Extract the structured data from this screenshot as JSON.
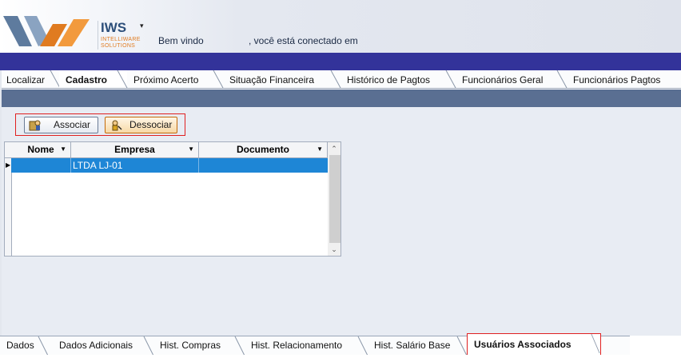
{
  "header": {
    "brand_name": "IWS",
    "brand_sub1": "INTELLIWARE",
    "brand_sub2": "SOLUTIONS",
    "menu_arrow": "▾",
    "welcome": "Bem vindo",
    "connected": ", você está conectado em"
  },
  "top_tabs": [
    {
      "label": "Localizar"
    },
    {
      "label": "Cadastro",
      "active": true
    },
    {
      "label": "Próximo Acerto"
    },
    {
      "label": "Situação Financeira"
    },
    {
      "label": "Histórico de Pagtos"
    },
    {
      "label": "Funcionários Geral"
    },
    {
      "label": "Funcionários Pagtos"
    }
  ],
  "toolbar": {
    "associar_label": "Associar",
    "dessociar_label": "Dessociar"
  },
  "grid": {
    "columns": [
      "Nome",
      "Empresa",
      "Documento"
    ],
    "rows": [
      {
        "nome": "",
        "empresa": "LTDA LJ-01",
        "documento": "",
        "selected": true
      }
    ]
  },
  "bottom_tabs": [
    {
      "label": "Dados"
    },
    {
      "label": "Dados Adicionais"
    },
    {
      "label": "Hist. Compras"
    },
    {
      "label": "Hist. Relacionamento"
    },
    {
      "label": "Hist. Salário Base"
    },
    {
      "label": "Usuários Associados",
      "active": true
    }
  ],
  "colors": {
    "navbar": "#33339a",
    "section_bar": "#5a6f92",
    "selection": "#1e86d6",
    "highlight_border": "#e02020",
    "brand_blue": "#2d4f7a",
    "brand_orange": "#e07b20"
  }
}
